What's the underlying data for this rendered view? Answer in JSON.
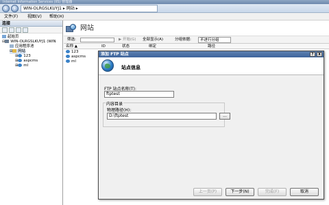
{
  "window": {
    "title": "Internet Information Services (IIS) 管理器"
  },
  "address": {
    "server": "WIN-OLRGSLKUYJ1",
    "sep": "▸",
    "page": "网站",
    "sep2": "▸"
  },
  "menu": {
    "file": "文件(F)",
    "view": "视图(V)",
    "help": "帮助(H)"
  },
  "connections": {
    "header": "连接",
    "tree": [
      {
        "label": "起始页",
        "icon": "home-icon"
      },
      {
        "label": "WIN-OLRGSLKUYJ1 (WIN",
        "icon": "server-icon"
      },
      {
        "label": "应用程序池",
        "icon": "app-pool-icon"
      },
      {
        "label": "网站",
        "icon": "folder-icon"
      },
      {
        "label": "123",
        "icon": "globe-icon"
      },
      {
        "label": "aspcms",
        "icon": "globe-icon"
      },
      {
        "label": "ml",
        "icon": "globe-icon"
      }
    ]
  },
  "main": {
    "title": "网站",
    "filter": {
      "label": "筛选:",
      "start": "▶ 开始(G)",
      "show_all": "全部显示(A)",
      "group": "分组依据:",
      "group_value": "不进行分组"
    },
    "columns": [
      "名称 ▲",
      "ID",
      "状态",
      "绑定",
      "路径"
    ],
    "sites": [
      "123",
      "aspcms",
      "ml"
    ]
  },
  "dialog": {
    "title": "添加 FTP 站点",
    "help": "?",
    "close": "X",
    "heading": "站点信息",
    "site_name_label": "FTP 站点名称(T):",
    "site_name_value": "ftptest",
    "content_dir_label": "内容目录",
    "physical_path_label": "物理路径(H):",
    "physical_path_value": "D:\\ftptest",
    "browse": "...",
    "buttons": {
      "prev": "上一页(P)",
      "next": "下一步(N)",
      "finish": "完成(F)",
      "cancel": "取消"
    }
  }
}
